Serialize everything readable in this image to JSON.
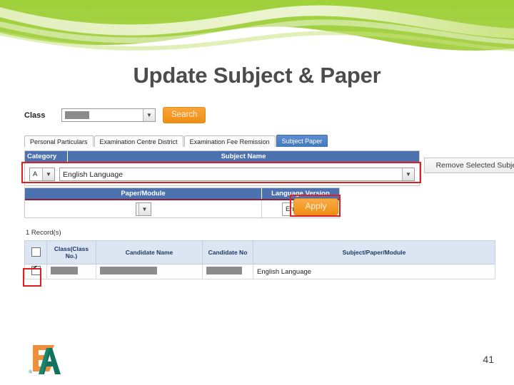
{
  "slide": {
    "title": "Update Subject & Paper",
    "page_number": "41",
    "logo_alt": "EA logo",
    "accent_green": "#9ACD32",
    "title_color": "#4c4c4c"
  },
  "search_bar": {
    "class_label": "Class",
    "class_value": "",
    "class_value_redacted": true,
    "search_button": "Search",
    "search_button_color": "#ef8e12"
  },
  "tabs": [
    {
      "label": "Personal Particulars",
      "active": false
    },
    {
      "label": "Examination Centre District",
      "active": false
    },
    {
      "label": "Examination Fee Remission",
      "active": false
    },
    {
      "label": "Subject Paper",
      "active": true
    }
  ],
  "subject_panel": {
    "header_color": "#4d72b0",
    "columns": [
      "Category",
      "Subject Name"
    ],
    "category_value": "A",
    "subject_value": "English Language",
    "highlighted": true,
    "remove_button": "Remove Selected Subject"
  },
  "paper_panel": {
    "columns": [
      "Paper/Module",
      "Language Version"
    ],
    "paper_value": "",
    "language_value": "English",
    "apply_button": "Apply",
    "apply_highlighted": true
  },
  "results": {
    "record_count": "1  Record(s)",
    "headers": [
      "",
      "Class(Class No.)",
      "Candidate Name",
      "Candidate No",
      "Subject/Paper/Module"
    ],
    "rows": [
      {
        "checked": true,
        "class_no": "",
        "class_no_redacted": true,
        "candidate_name": "",
        "candidate_name_redacted": true,
        "candidate_no": "",
        "candidate_no_redacted": true,
        "subject": "English Language"
      }
    ]
  }
}
